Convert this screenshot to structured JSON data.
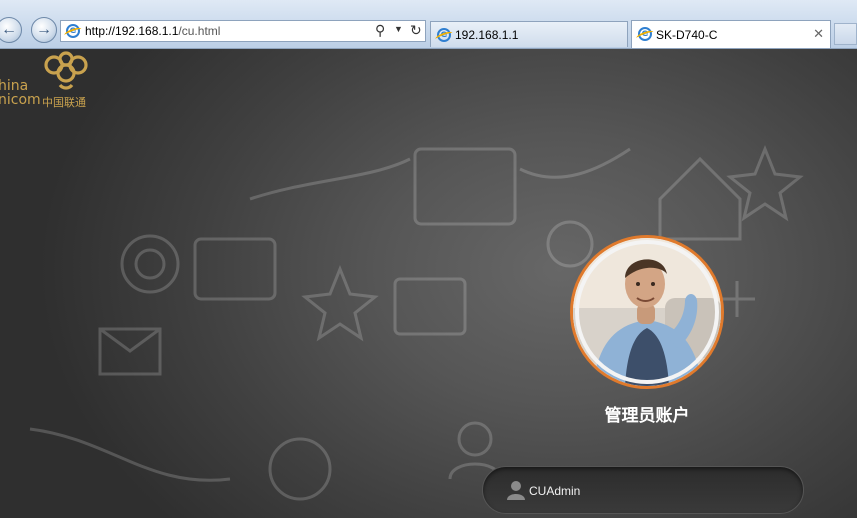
{
  "browser": {
    "address": {
      "host": "http://192.168.1.1",
      "path": "/cu.html"
    },
    "tabs": [
      {
        "label": "192.168.1.1"
      },
      {
        "label": "SK-D740-C"
      }
    ],
    "icons": {
      "back": "back-arrow-icon",
      "forward": "forward-arrow-icon",
      "search": "search-icon",
      "refresh": "refresh-icon",
      "close": "close-icon"
    }
  },
  "logo": {
    "en_line1": "hina",
    "en_line2": "nicom",
    "cn": "中国联通",
    "color": "#c9a24e"
  },
  "login": {
    "account_title": "管理员账户",
    "username_value": "CUAdmin",
    "accent_color": "#e07a2c"
  }
}
